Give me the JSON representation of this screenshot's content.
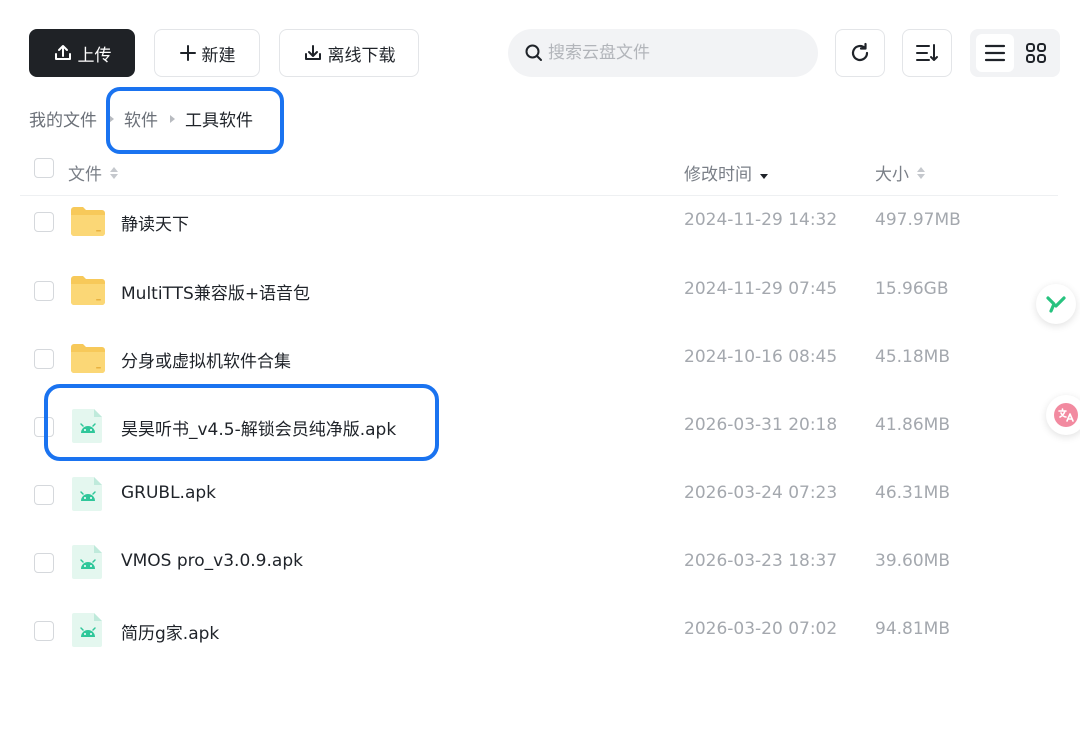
{
  "toolbar": {
    "upload_label": "上传",
    "new_label": "新建",
    "offline_label": "离线下载",
    "search_placeholder": "搜索云盘文件"
  },
  "breadcrumb": [
    {
      "label": "我的文件"
    },
    {
      "label": "软件"
    },
    {
      "label": "工具软件"
    }
  ],
  "columns": {
    "name": "文件",
    "time": "修改时间",
    "size": "大小"
  },
  "files": [
    {
      "type": "folder",
      "name": "静读天下",
      "time": "2024-11-29 14:32",
      "size": "497.97MB"
    },
    {
      "type": "folder",
      "name": "MultiTTS兼容版+语音包",
      "time": "2024-11-29 07:45",
      "size": "15.96GB"
    },
    {
      "type": "folder",
      "name": "分身或虚拟机软件合集",
      "time": "2024-10-16 08:45",
      "size": "45.18MB"
    },
    {
      "type": "apk",
      "name": "昊昊听书_v4.5-解锁会员纯净版.apk",
      "time": "2026-03-31 20:18",
      "size": "41.86MB"
    },
    {
      "type": "apk",
      "name": "GRUBL.apk",
      "time": "2026-03-24 07:23",
      "size": "46.31MB"
    },
    {
      "type": "apk",
      "name": "VMOS pro_v3.0.9.apk",
      "time": "2026-03-23 18:37",
      "size": "39.60MB"
    },
    {
      "type": "apk",
      "name": "简历g家.apk",
      "time": "2026-03-20 07:02",
      "size": "94.81MB"
    }
  ],
  "colors": {
    "primary_button": "#1f2226",
    "highlight": "#1a73f0",
    "folder": "#f7c95a",
    "apk_accent": "#2fc79a"
  }
}
